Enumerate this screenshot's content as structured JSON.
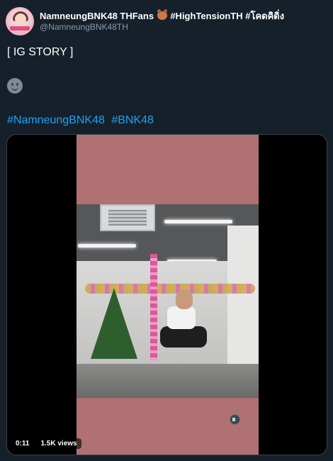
{
  "tweet": {
    "display_name": "NamneungBNK48 THFans",
    "display_name_tags": "#HighTensionTH #โคดคิดิ่ง",
    "handle": "@NamneungBNK48TH",
    "text": "[ IG STORY ]",
    "emoji": "slight-smile",
    "hashtags": [
      "#NamneungBNK48",
      "#BNK48"
    ]
  },
  "video": {
    "time": "0:11",
    "views": "1.5K views"
  },
  "colors": {
    "background": "#15202b",
    "link": "#1da1f2",
    "muted_text": "#8899a6",
    "frame_pink": "#b07172"
  }
}
